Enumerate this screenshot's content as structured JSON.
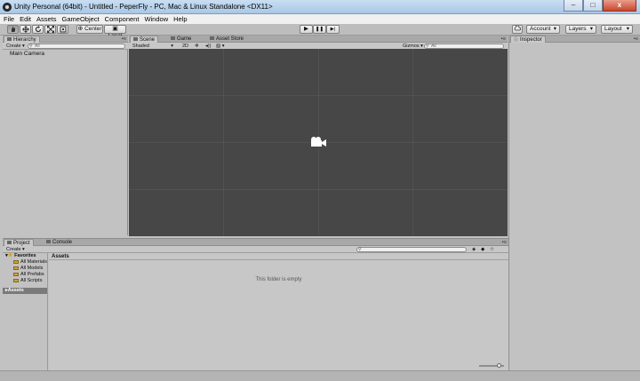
{
  "window": {
    "title": "Unity Personal (64bit) - Untitled - PeperFly - PC, Mac & Linux Standalone <DX11>",
    "minimize_glyph": "–",
    "maximize_glyph": "□",
    "close_glyph": "x"
  },
  "menu": [
    "File",
    "Edit",
    "Assets",
    "GameObject",
    "Component",
    "Window",
    "Help"
  ],
  "toolbar": {
    "pivot_label": "Center",
    "space_label": "Local",
    "play_glyph": "▶",
    "pause_glyph": "❚❚",
    "step_glyph": "▶|",
    "account_label": "Account",
    "layers_label": "Layers",
    "layout_label": "Layout",
    "dropdown_glyph": "▾"
  },
  "hierarchy": {
    "tab_label": "Hierarchy",
    "create_label": "Create",
    "search_placeholder": "All",
    "items": [
      "Main Camera"
    ]
  },
  "scene": {
    "tabs": [
      "Scene",
      "Game",
      "Asset Store"
    ],
    "shading_label": "Shaded",
    "mode_2d_label": "2D",
    "gizmos_label": "Gizmos",
    "search_placeholder": "All"
  },
  "inspector": {
    "tab_label": "Inspector"
  },
  "project": {
    "tabs": [
      "Project",
      "Console"
    ],
    "create_label": "Create",
    "favorites_label": "Favorites",
    "favorites": [
      "All Materials",
      "All Models",
      "All Prefabs",
      "All Scripts"
    ],
    "assets_label": "Assets",
    "path_label": "Assets",
    "empty_message": "This folder is empty"
  },
  "colors": {
    "scene_background": "#474747",
    "panel_background": "#c2c2c2",
    "title_bar": "#b9d3ee"
  }
}
